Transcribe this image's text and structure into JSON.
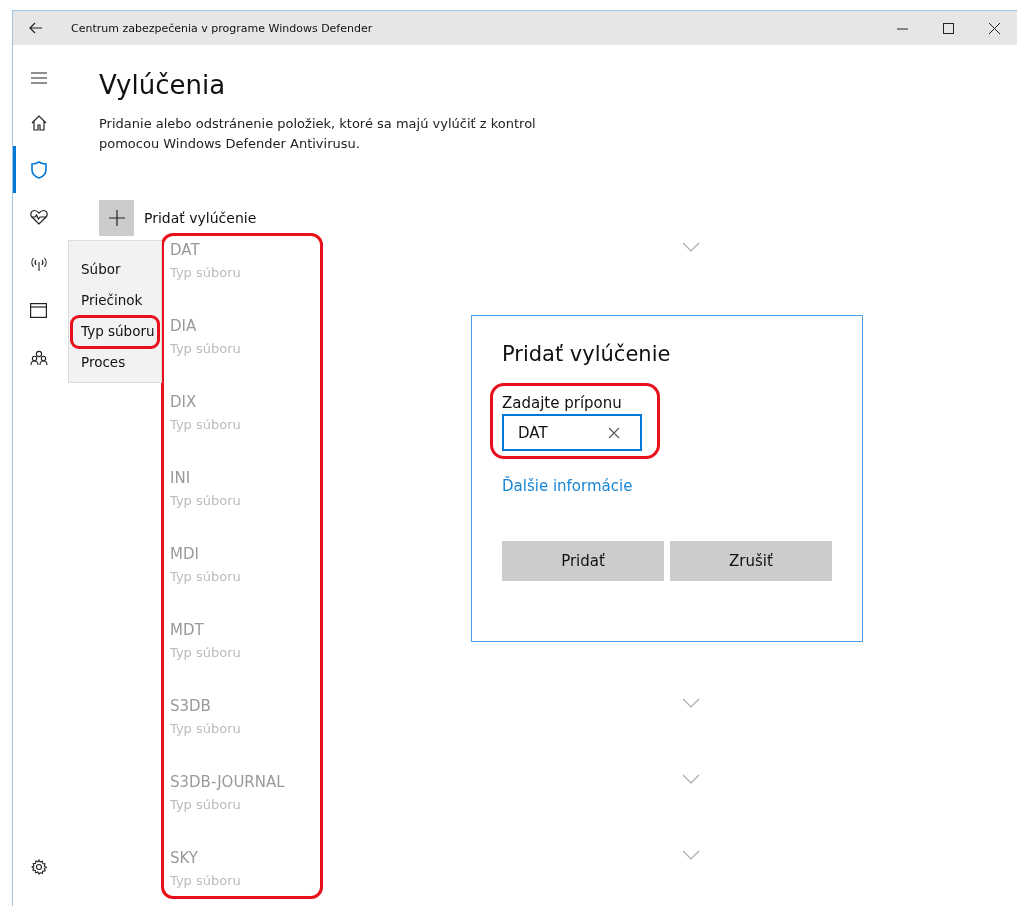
{
  "window": {
    "title": "Centrum zabezpečenia v programe Windows Defender"
  },
  "sidebar": {
    "items": [
      {
        "kind": "home",
        "selected": false
      },
      {
        "kind": "shield",
        "selected": true
      },
      {
        "kind": "health",
        "selected": false
      },
      {
        "kind": "network",
        "selected": false
      },
      {
        "kind": "app",
        "selected": false
      },
      {
        "kind": "family",
        "selected": false
      }
    ]
  },
  "page": {
    "title": "Vylúčenia",
    "description": "Pridanie alebo odstránenie položiek, ktoré sa majú vylúčiť z kontrol pomocou Windows Defender Antivirusu.",
    "add_button": "Pridať vylúčenie"
  },
  "menu": {
    "items": [
      {
        "label": "Súbor",
        "highlighted": false
      },
      {
        "label": "Priečinok",
        "highlighted": false
      },
      {
        "label": "Typ súboru",
        "highlighted": true
      },
      {
        "label": "Proces",
        "highlighted": false
      }
    ]
  },
  "exclusions": {
    "highlighted": true,
    "items": [
      {
        "name": "DAT",
        "type": "Typ súboru"
      },
      {
        "name": "DIA",
        "type": "Typ súboru"
      },
      {
        "name": "DIX",
        "type": "Typ súboru"
      },
      {
        "name": "INI",
        "type": "Typ súboru"
      },
      {
        "name": "MDI",
        "type": "Typ súboru"
      },
      {
        "name": "MDT",
        "type": "Typ súboru"
      },
      {
        "name": "S3DB",
        "type": "Typ súboru"
      },
      {
        "name": "S3DB-JOURNAL",
        "type": "Typ súboru"
      },
      {
        "name": "SKY",
        "type": "Typ súboru"
      }
    ]
  },
  "dialog": {
    "title": "Pridať vylúčenie",
    "field_label": "Zadajte príponu",
    "value": "DAT",
    "highlighted": true,
    "link": "Ďalšie informácie",
    "buttons": [
      "Pridať",
      "Zrušiť"
    ]
  }
}
